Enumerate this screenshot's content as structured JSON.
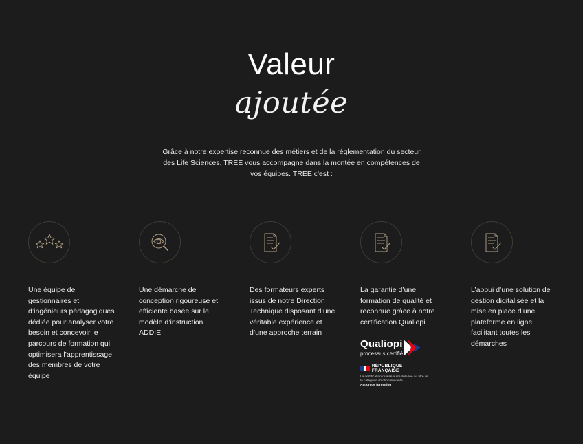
{
  "header": {
    "title": "Valeur",
    "subtitle": "ajoutée"
  },
  "intro": "Grâce à notre expertise reconnue des métiers et de la réglementation du secteur des Life Sciences, TREE vous accompagne dans la montée en compétences de vos équipes. TREE c'est :",
  "features": [
    {
      "icon": "stars-icon",
      "text": "Une équipe de gestionnaires et d’ingénieurs pédagogiques dédiée pour analyser votre besoin et concevoir le parcours de formation qui optimisera l’apprentissage des membres de votre équipe"
    },
    {
      "icon": "eye-magnifier-icon",
      "text": "Une démarche de conception rigoureuse et efficiente basée sur le modèle d’instruction ADDIE"
    },
    {
      "icon": "document-check-icon",
      "text": "Des formateurs experts issus de notre Direction Technique disposant d’une véritable expérience et d’une approche terrain"
    },
    {
      "icon": "document-check-icon",
      "text": "La garantie d’une formation de qualité et reconnue grâce à notre certification Qualiopi"
    },
    {
      "icon": "document-check-icon",
      "text": "L’appui d’une solution de gestion digitalisée et la mise en place d’une plateforme en ligne facilitant toutes les démarches"
    }
  ],
  "qualiopi": {
    "name": "Qualiopi",
    "tagline": "processus certifié",
    "republic": "RÉPUBLIQUE FRANÇAISE",
    "note": "La certification qualité a été délivrée au titre de la catégorie d'action suivante :",
    "action": "Action de formation"
  },
  "colors": {
    "background": "#1c1c1c",
    "icon_stroke": "#b5a488",
    "circle_border": "#3f3a33",
    "qualiopi_red": "#e30613",
    "qualiopi_blue": "#1d3c8c"
  }
}
